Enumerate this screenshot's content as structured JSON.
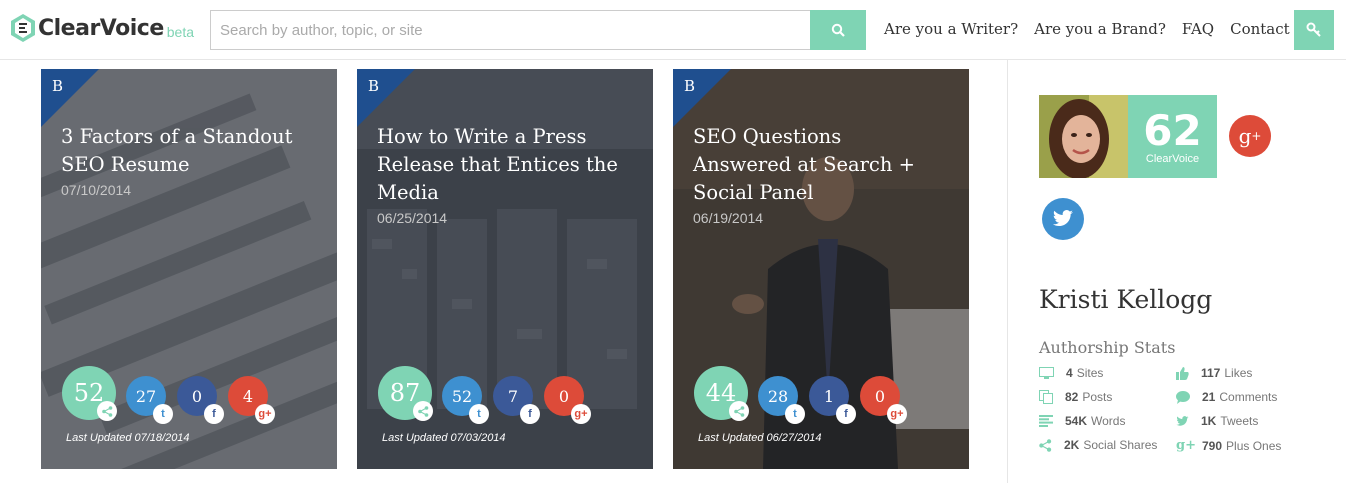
{
  "header": {
    "logo_text": "ClearVoice",
    "logo_beta": "beta",
    "search_placeholder": "Search by author, topic, or site",
    "nav": [
      "Are you a Writer?",
      "Are you a Brand?",
      "FAQ",
      "Contact Us"
    ]
  },
  "colors": {
    "accent": "#7fd4b4",
    "twitter": "#3e90d0",
    "facebook": "#3b5998",
    "google": "#dd4b39",
    "badge": "#1f4f8f"
  },
  "cards": [
    {
      "badge": "B",
      "title": "3 Factors of a Standout SEO Resume",
      "date": "07/10/2014",
      "score": "52",
      "twitter": "27",
      "facebook": "0",
      "google": "4",
      "updated": "Last Updated 07/18/2014"
    },
    {
      "badge": "B",
      "title": "How to Write a Press Release that Entices the Media",
      "date": "06/25/2014",
      "score": "87",
      "twitter": "52",
      "facebook": "7",
      "google": "0",
      "updated": "Last Updated 07/03/2014"
    },
    {
      "badge": "B",
      "title": "SEO Questions Answered at Search + Social Panel",
      "date": "06/19/2014",
      "score": "44",
      "twitter": "28",
      "facebook": "1",
      "google": "0",
      "updated": "Last Updated 06/27/2014"
    }
  ],
  "author": {
    "name": "Kristi Kellogg",
    "score": "62",
    "score_label": "ClearVoice",
    "stats_title": "Authorship Stats",
    "stats": [
      {
        "value": "4",
        "label": "Sites",
        "icon": "monitor-icon"
      },
      {
        "value": "117",
        "label": "Likes",
        "icon": "thumbs-up-icon"
      },
      {
        "value": "82",
        "label": "Posts",
        "icon": "copy-icon"
      },
      {
        "value": "21",
        "label": "Comments",
        "icon": "comment-icon"
      },
      {
        "value": "54K",
        "label": "Words",
        "icon": "text-lines-icon"
      },
      {
        "value": "1K",
        "label": "Tweets",
        "icon": "twitter-icon"
      },
      {
        "value": "2K",
        "label": "Social Shares",
        "icon": "share-icon"
      },
      {
        "value": "790",
        "label": "Plus Ones",
        "icon": "google-plus-icon"
      }
    ]
  }
}
